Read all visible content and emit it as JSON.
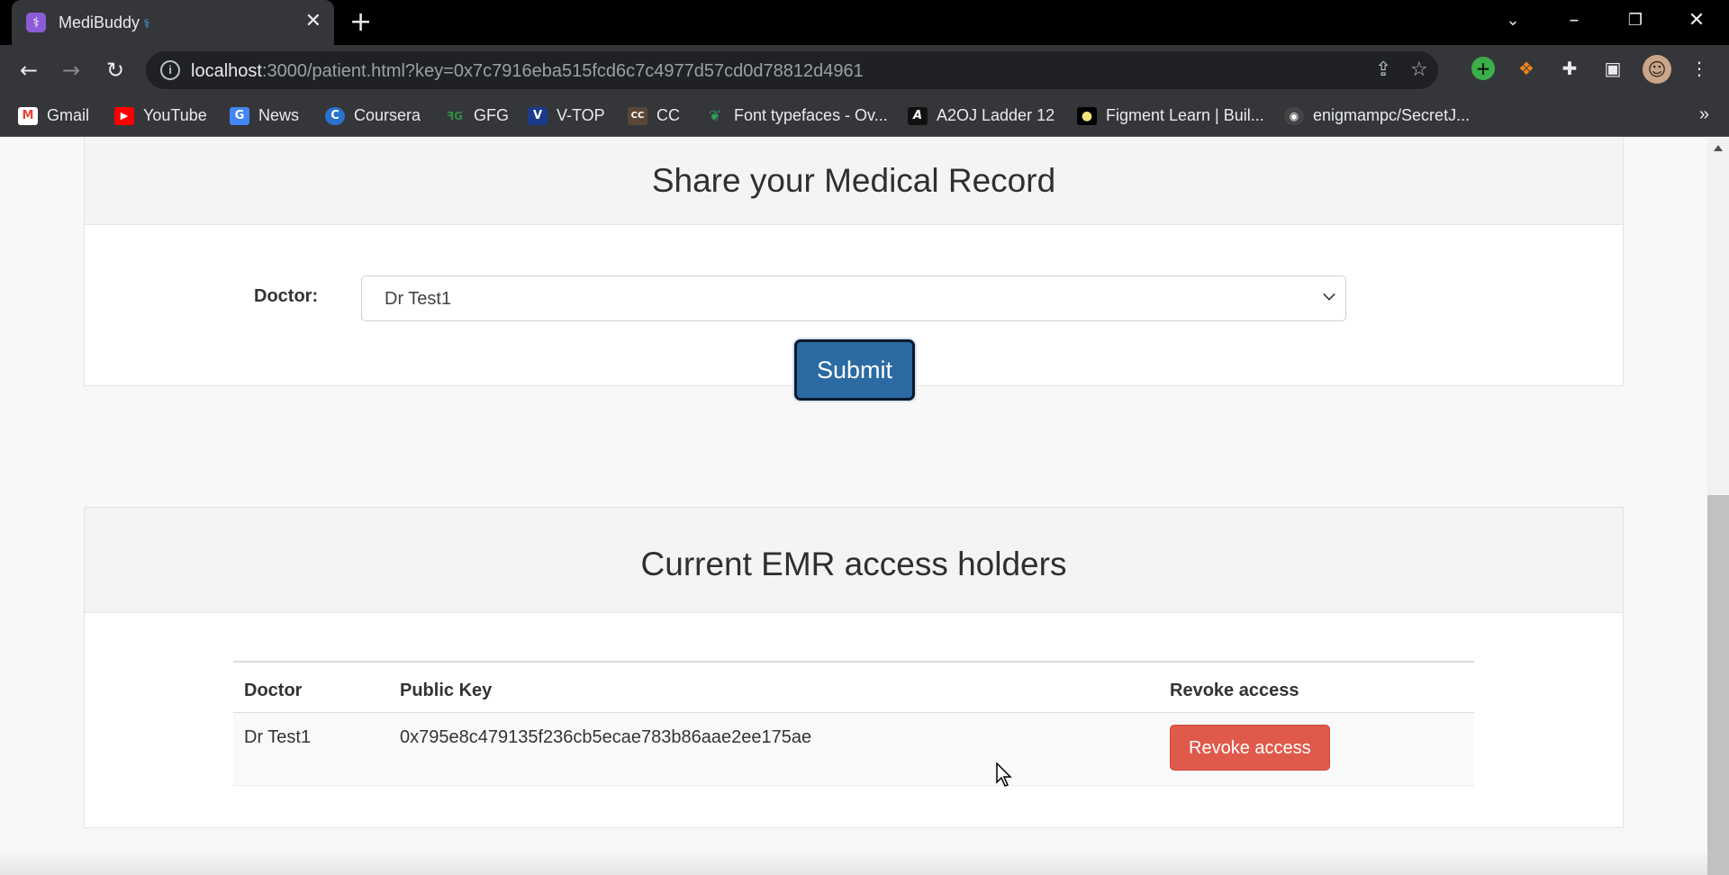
{
  "browser": {
    "tab_title": "MediBuddy",
    "tab_ext_mark": "⚕",
    "new_tab_symbol": "+",
    "close_symbol": "✕",
    "url_host": "localhost",
    "url_rest": ":3000/patient.html?key=0x7c7916eba515fcd6c7c4977d57cd0d78812d4961",
    "bookmarks": [
      {
        "label": "Gmail",
        "icon": "gmail-icon",
        "color": "#ea4335",
        "glyph": "M"
      },
      {
        "label": "YouTube",
        "icon": "youtube-icon",
        "color": "#ff0000",
        "glyph": "▶"
      },
      {
        "label": "News",
        "icon": "google-news-icon",
        "color": "#4285f4",
        "glyph": "G"
      },
      {
        "label": "Coursera",
        "icon": "coursera-icon",
        "color": "#2a73cc",
        "glyph": "C"
      },
      {
        "label": "GFG",
        "icon": "gfg-icon",
        "color": "#2f8d46",
        "glyph": "ꟻG"
      },
      {
        "label": "V-TOP",
        "icon": "vtop-icon",
        "color": "#1b3a8a",
        "glyph": "V"
      },
      {
        "label": "CC",
        "icon": "codechef-icon",
        "color": "#5b4638",
        "glyph": "CC"
      },
      {
        "label": "Font typefaces - Ov...",
        "icon": "leaf-icon",
        "color": "#2e9e5b",
        "glyph": "❦"
      },
      {
        "label": "A2OJ Ladder 12",
        "icon": "a2oj-icon",
        "color": "#111111",
        "glyph": "A"
      },
      {
        "label": "Figment Learn | Buil...",
        "icon": "figment-icon",
        "color": "#f2e27a",
        "glyph": "●"
      },
      {
        "label": "enigmampc/SecretJ...",
        "icon": "github-icon",
        "color": "#444444",
        "glyph": "◉"
      }
    ],
    "bookmarks_more": "»"
  },
  "share_card": {
    "title": "Share your Medical Record",
    "doctor_label": "Doctor:",
    "doctor_selected": "Dr Test1",
    "submit_label": "Submit"
  },
  "access_card": {
    "title": "Current EMR access holders",
    "headers": [
      "Doctor",
      "Public Key",
      "Revoke access"
    ],
    "rows": [
      {
        "doctor": "Dr Test1",
        "public_key": "0x795e8c479135f236cb5ecae783b86aae2ee175ae",
        "action": "Revoke access"
      }
    ]
  },
  "colors": {
    "submit": "#2b6aa3",
    "revoke": "#e05a4b"
  }
}
